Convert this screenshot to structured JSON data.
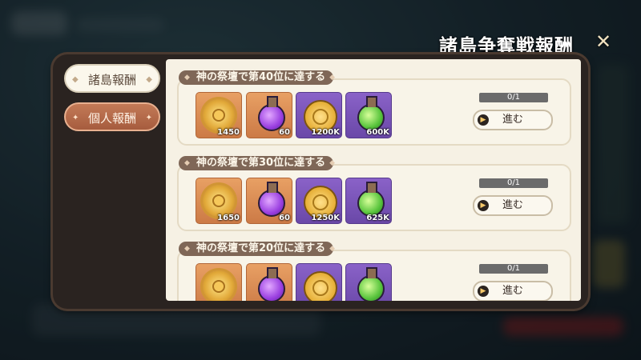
{
  "header": {
    "title": "諸島争奪戦報酬",
    "close_symbol": "✕"
  },
  "tabs": [
    {
      "label": "諸島報酬",
      "selected": true
    },
    {
      "label": "個人報酬",
      "selected": false
    }
  ],
  "missions": [
    {
      "label": "神の祭壇で第40位に達する",
      "progress_text": "0/1",
      "progress_fraction": 0,
      "button_label": "進む",
      "rewards": [
        {
          "icon": "gear-token-icon",
          "count": "1450"
        },
        {
          "icon": "purple-potion-icon",
          "count": "60"
        },
        {
          "icon": "gold-coin-icon",
          "count": "1200K"
        },
        {
          "icon": "green-potion-icon",
          "count": "600K"
        }
      ]
    },
    {
      "label": "神の祭壇で第30位に達する",
      "progress_text": "0/1",
      "progress_fraction": 0,
      "button_label": "進む",
      "rewards": [
        {
          "icon": "gear-token-icon",
          "count": "1650"
        },
        {
          "icon": "purple-potion-icon",
          "count": "60"
        },
        {
          "icon": "gold-coin-icon",
          "count": "1250K"
        },
        {
          "icon": "green-potion-icon",
          "count": "625K"
        }
      ]
    },
    {
      "label": "神の祭壇で第20位に達する",
      "progress_text": "0/1",
      "progress_fraction": 0,
      "button_label": "進む",
      "rewards": [
        {
          "icon": "gear-token-icon",
          "count": ""
        },
        {
          "icon": "purple-potion-icon",
          "count": ""
        },
        {
          "icon": "gold-coin-icon",
          "count": ""
        },
        {
          "icon": "green-potion-icon",
          "count": ""
        }
      ]
    }
  ],
  "colors": {
    "accent": "#7f6757",
    "selected_tab": "#a65c3e",
    "panel": "#f6f1e4"
  }
}
